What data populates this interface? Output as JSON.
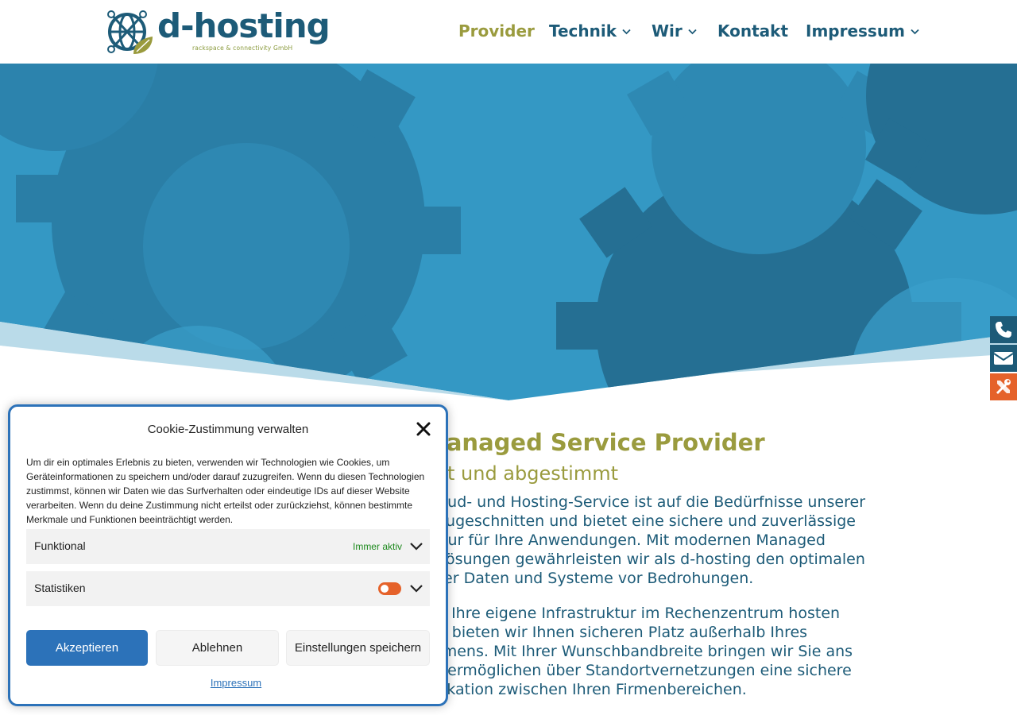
{
  "brand": {
    "name": "d-hosting",
    "tagline": "rackspace & connectivity GmbH",
    "primary_color": "#1d5b78",
    "accent_color": "#9a9b3e",
    "hero_color": "#2e8db8"
  },
  "nav": {
    "items": [
      {
        "label": "Provider",
        "active": true,
        "has_submenu": false
      },
      {
        "label": "Technik",
        "active": false,
        "has_submenu": true
      },
      {
        "label": "Wir",
        "active": false,
        "has_submenu": true
      },
      {
        "label": "Kontakt",
        "active": false,
        "has_submenu": false
      },
      {
        "label": "Impressum",
        "active": false,
        "has_submenu": true
      }
    ]
  },
  "sidebar": {
    "buttons": [
      {
        "icon": "phone-icon"
      },
      {
        "icon": "envelope-icon"
      },
      {
        "icon": "tools-icon"
      }
    ]
  },
  "content": {
    "heading": "Managed Service Provider",
    "subheading": "ent und abgestimmt",
    "paragraph1": [
      "Cloud- und Hosting-Service ist auf die Bedürfnisse unserer",
      "n zugeschnitten und bietet eine sichere und zuverlässige",
      "uktur für Ihre Anwendungen. Mit modernen Managed",
      "y-Lösungen gewährleisten wir als d-hosting den optimalen",
      "Ihrer Daten und Systeme vor Bedrohungen."
    ],
    "paragraph2": [
      "Sie Ihre eigene Infrastruktur im Rechenzentrum hosten",
      "en, bieten wir Ihnen sicheren Platz außerhalb Ihres",
      "ehmens. Mit Ihrer Wunschbandbreite bringen wir Sie ans",
      "nd ermöglichen über Standortvernetzungen eine sichere",
      "unikation zwischen Ihren Firmenbereichen."
    ]
  },
  "cookie": {
    "title": "Cookie-Zustimmung verwalten",
    "text": [
      "Um dir ein optimales Erlebnis zu bieten, verwenden wir Technologien wie Cookies, um",
      "Geräteinformationen zu speichern und/oder darauf zuzugreifen. Wenn du diesen Technologien",
      "zustimmst, können wir Daten wie das Surfverhalten oder eindeutige IDs auf dieser Website",
      "verarbeiten. Wenn du deine Zustimmung nicht erteilst oder zurückziehst, können bestimmte",
      "Merkmale und Funktionen beeinträchtigt werden."
    ],
    "categories": [
      {
        "label": "Funktional",
        "status": "Immer aktiv"
      },
      {
        "label": "Statistiken",
        "toggle_on": false
      }
    ],
    "buttons": {
      "accept": "Akzeptieren",
      "deny": "Ablehnen",
      "save": "Einstellungen speichern"
    },
    "link": "Impressum",
    "accent_color": "#2c72b9",
    "toggle_color": "#e5622a"
  }
}
